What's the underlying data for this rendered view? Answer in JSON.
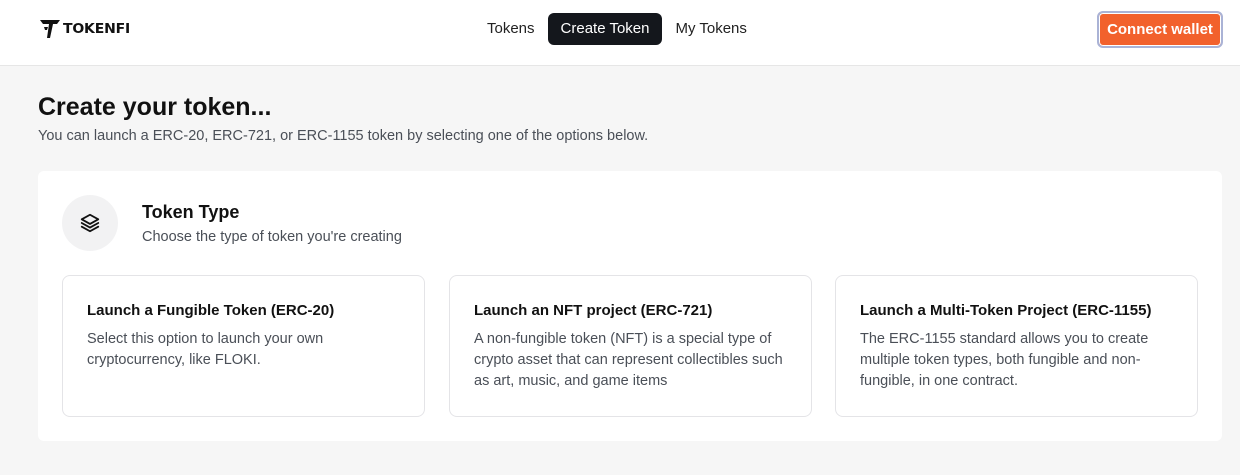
{
  "header": {
    "logo_text": "TOKENFI",
    "nav": [
      {
        "label": "Tokens"
      },
      {
        "label": "Create Token"
      },
      {
        "label": "My Tokens"
      }
    ],
    "connect_wallet_label": "Connect wallet",
    "accent_color": "#f2612c"
  },
  "main": {
    "title": "Create your token...",
    "subtitle": "You can launch a ERC-20, ERC-721, or ERC-1155 token by selecting one of the options below.",
    "section": {
      "icon": "layers-icon",
      "title": "Token Type",
      "subtitle": "Choose the type of token you're creating"
    },
    "options": [
      {
        "title": "Launch a Fungible Token (ERC-20)",
        "description": "Select this option to launch your own cryptocurrency, like FLOKI."
      },
      {
        "title": "Launch an NFT project (ERC-721)",
        "description": "A non-fungible token (NFT) is a special type of crypto asset that can represent collectibles such as art, music, and game items"
      },
      {
        "title": "Launch a Multi-Token Project (ERC-1155)",
        "description": "The ERC-1155 standard allows you to create multiple token types, both fungible and non-fungible, in one contract."
      }
    ]
  }
}
